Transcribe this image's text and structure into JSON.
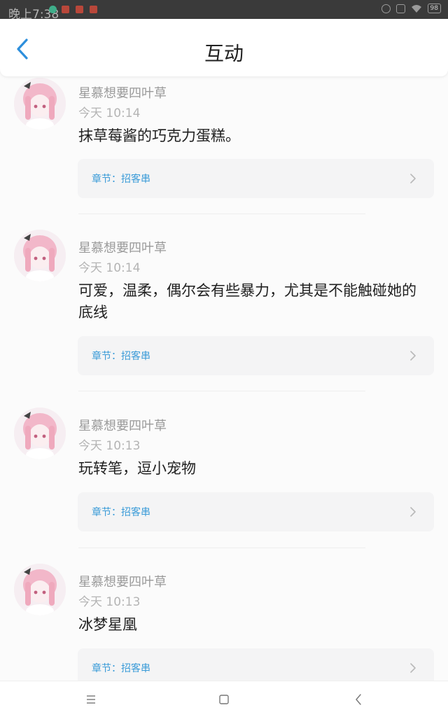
{
  "status_bar": {
    "time": "晚上7:38",
    "battery": "98",
    "notif_colors": [
      "#3fae8a",
      "#e0533f",
      "#e0533f",
      "#e0533f"
    ]
  },
  "header": {
    "title": "互动",
    "back_icon": "chevron-left-icon",
    "accent_color": "#2d8fdc"
  },
  "comments": [
    {
      "user": "星慕想要四叶草",
      "time": "今天 10:14",
      "content": "抹草莓酱的巧克力蛋糕。",
      "chapter": "章节：招客串"
    },
    {
      "user": "星慕想要四叶草",
      "time": "今天 10:14",
      "content": "可爱，温柔，偶尔会有些暴力，尤其是不能触碰她的底线",
      "chapter": "章节：招客串"
    },
    {
      "user": "星慕想要四叶草",
      "time": "今天 10:13",
      "content": "玩转笔，逗小宠物",
      "chapter": "章节：招客串"
    },
    {
      "user": "星慕想要四叶草",
      "time": "今天 10:13",
      "content": "冰梦星凰",
      "chapter": "章节：招客串"
    }
  ],
  "nav": {
    "menu_icon": "menu-icon",
    "home_icon": "square-home-icon",
    "back_icon": "triangle-back-icon"
  }
}
